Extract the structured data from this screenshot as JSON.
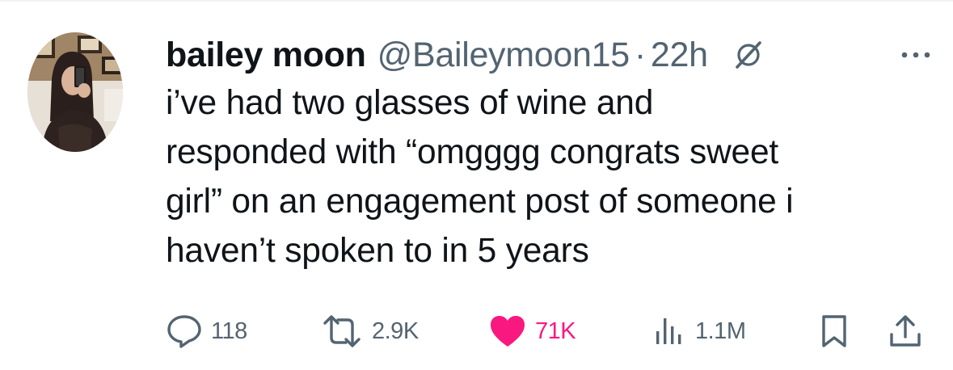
{
  "tweet": {
    "display_name": "bailey moon",
    "handle": "@Baileymoon15",
    "separator": "·",
    "timestamp": "22h",
    "text": "i’ve had two glasses of wine and\nresponded with “omgggg congrats sweet\ngirl” on an engagement post of someone i\nhaven’t spoken to in 5 years"
  },
  "header_icons": {
    "grok": "grok-icon",
    "more": "more-dots-icon"
  },
  "actions": {
    "replies": {
      "icon": "reply-icon",
      "count": "118"
    },
    "reposts": {
      "icon": "repost-icon",
      "count": "2.9K"
    },
    "likes": {
      "icon": "heart-icon",
      "count": "71K",
      "color": "#f91880"
    },
    "views": {
      "icon": "views-chart-icon",
      "count": "1.1M"
    },
    "bookmark": {
      "icon": "bookmark-icon"
    },
    "share": {
      "icon": "share-icon"
    }
  },
  "colors": {
    "text_primary": "#0f1419",
    "text_secondary": "#536471",
    "like_pink": "#f91880"
  }
}
